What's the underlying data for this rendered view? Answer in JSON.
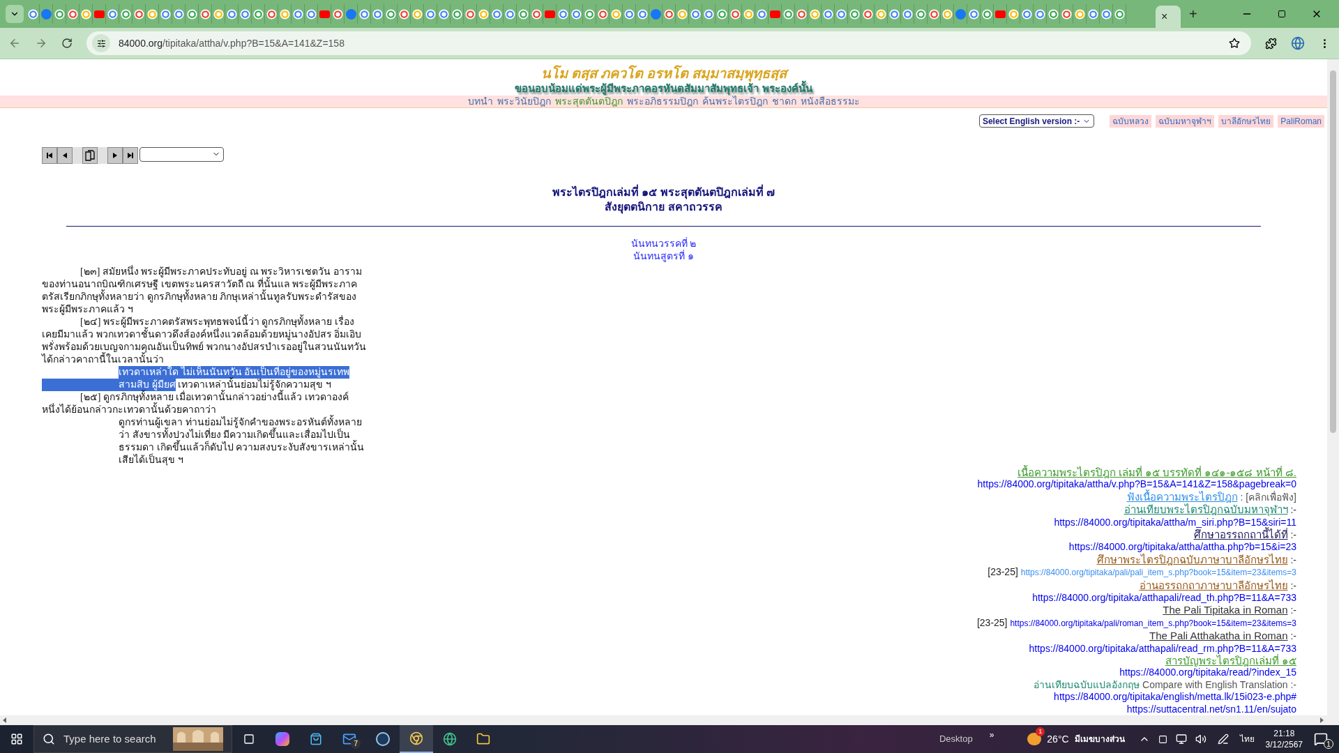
{
  "browser": {
    "url_host": "84000.org",
    "url_path": "/tipitaka/attha/v.php?B=15&A=141&Z=158",
    "close_tab": "×",
    "new_tab": "+"
  },
  "header": {
    "title": "นโม ตสฺส ภควโต อรหโต สมฺมาสมฺพุทฺธสฺส",
    "subtitle": "ขอนอบน้อมแด่พระผู้มีพระภาคอรหันตสัมมาสัมพุทธเจ้า  พระองค์นั้น"
  },
  "nav": [
    {
      "label": "บทนำ",
      "selected": false
    },
    {
      "label": "พระวินัยปิฎก",
      "selected": false
    },
    {
      "label": "พระสุตตันตปิฎก",
      "selected": true
    },
    {
      "label": "พระอภิธรรมปิฎก",
      "selected": false
    },
    {
      "label": "ค้นพระไตรปิฎก",
      "selected": false
    },
    {
      "label": "ชาดก",
      "selected": false
    },
    {
      "label": "หนังสือธรรมะ",
      "selected": false
    }
  ],
  "version_select": "Select English version :-",
  "version_links": [
    "ฉบับหลวง",
    "ฉบับมหาจุฬาฯ",
    "บาลีอักษรไทย",
    "PaliRoman"
  ],
  "title": [
    "พระไตรปิฎกเล่มที่ ๑๕ พระสุตตันตปิฎกเล่มที่ ๗",
    "สังยุตตนิกาย สคาถวรรค"
  ],
  "subheads": [
    "นันทนวรรคที่ ๒",
    "นันทนสูตรที่ ๑"
  ],
  "body": [
    {
      "kind": "para",
      "lines": [
        "[๒๓] สมัยหนึ่ง พระผู้มีพระภาคประทับอยู่ ณ พระวิหารเชตวัน อาราม",
        "ของท่านอนาถบิณฑิกเศรษฐี เขตพระนครสาวัตถี ณ ที่นั้นแล พระผู้มีพระภาค",
        "ตรัสเรียกภิกษุทั้งหลายว่า ดูกรภิกษุทั้งหลาย ภิกษุเหล่านั้นทูลรับพระดำรัสของ",
        "พระผู้มีพระภาคแล้ว ฯ"
      ]
    },
    {
      "kind": "para",
      "lines": [
        "[๒๔] พระผู้มีพระภาคตรัสพระพุทธพจน์นี้ว่า ดูกรภิกษุทั้งหลาย เรื่อง",
        "เคยมีมาแล้ว พวกเทวดาชั้นดาวดึงส์องค์หนึ่งแวดล้อมด้วยหมู่นางอัปสร อิ่มเอิบ",
        "พรั่งพร้อมด้วยเบญจกามคุณอันเป็นทิพย์ พวกนางอัปสรบำเรออยู่ในสวนนันทวัน",
        "ได้กล่าวคาถานี้ในเวลานั้นว่า"
      ]
    },
    {
      "kind": "verse",
      "lines": [
        [
          {
            "text": "เทวดาเหล่าใด ไม่เห็นนันทวัน อันเป็นที่อยู่ของหมู่นรเทพ",
            "highlighted": true
          }
        ],
        [
          {
            "text": "สามสิบ ผู้มียศ",
            "highlighted": true
          },
          {
            "text": " เทวดาเหล่านั้นย่อมไม่รู้จักความสุข ฯ",
            "highlighted": false
          }
        ]
      ]
    },
    {
      "kind": "para",
      "lines": [
        "[๒๕] ดูกรภิกษุทั้งหลาย เมื่อเทวดานั้นกล่าวอย่างนี้แล้ว เทวดาองค์",
        "หนึ่งได้ย้อนกล่าวกะเทวดานั้นด้วยคาถาว่า"
      ]
    },
    {
      "kind": "verse",
      "lines": [
        [
          {
            "text": "ดูกรท่านผู้เขลา ท่านย่อมไม่รู้จักคำของพระอรหันต์ทั้งหลาย",
            "highlighted": false
          }
        ],
        [
          {
            "text": "ว่า สังขารทั้งปวงไม่เที่ยง มีความเกิดขึ้นและเสื่อมไปเป็น",
            "highlighted": false
          }
        ],
        [
          {
            "text": "ธรรมดา เกิดขึ้นแล้วก็ดับไป ความสงบระงับสังขารเหล่านั้น",
            "highlighted": false
          }
        ],
        [
          {
            "text": "เสียได้เป็นสุข ฯ",
            "highlighted": false
          }
        ]
      ]
    }
  ],
  "references": [
    [
      {
        "kind": "link",
        "text": "เนื้อความพระไตรปิฎก เล่มที่ ๑๕ บรรทัดที่ ๑๔๑-๑๕๘ หน้าที่ ๘.",
        "color": "#3f9a2e"
      }
    ],
    [
      {
        "kind": "url",
        "text": "https://84000.org/tipitaka/attha/v.php?B=15&A=141&Z=158&pagebreak=0",
        "color": "#0000ee"
      }
    ],
    [
      {
        "kind": "link",
        "text": "ฟังเนื้อความพระไตรปิฎก",
        "color": "#2f8fe8"
      },
      {
        "kind": "note",
        "text": " : [คลิกเพื่อฟัง]",
        "color": "#555555"
      }
    ],
    [
      {
        "kind": "link",
        "text": "อ่านเทียบพระไตรปิฎกฉบับมหาจุฬาฯ",
        "color": "#1e8a72"
      },
      {
        "kind": "note",
        "text": " :-",
        "color": "#333333"
      }
    ],
    [
      {
        "kind": "url",
        "text": "https://84000.org/tipitaka/attha/m_siri.php?B=15&siri=11",
        "color": "#0000ee"
      }
    ],
    [
      {
        "kind": "link",
        "text": "ศึกษาอรรถกถานี้ได้ที่",
        "color": "#1a1a5a"
      },
      {
        "kind": "note",
        "text": " :-",
        "color": "#333333"
      }
    ],
    [
      {
        "kind": "url",
        "text": "https://84000.org/tipitaka/attha/attha.php?b=15&i=23",
        "color": "#0000ee"
      }
    ],
    [
      {
        "kind": "link",
        "text": "ศึกษาพระไตรปิฎกฉบับภาษาบาลีอักษรไทย",
        "color": "#9a5a1a"
      },
      {
        "kind": "note",
        "text": " :-",
        "color": "#333333"
      }
    ],
    [
      {
        "kind": "note",
        "text": "[23-25] ",
        "color": "#222222"
      },
      {
        "kind": "small_url",
        "text": "https://84000.org/tipitaka/pali/pali_item_s.php?book=15&item=23&items=3",
        "color": "#3a8ef0"
      }
    ],
    [
      {
        "kind": "link",
        "text": "อ่านอรรถกถาภาษาบาลีอักษรไทย",
        "color": "#9a5a1a"
      },
      {
        "kind": "note",
        "text": " :-",
        "color": "#333333"
      }
    ],
    [
      {
        "kind": "url",
        "text": "https://84000.org/tipitaka/atthapali/read_th.php?B=11&A=733",
        "color": "#0000ee"
      }
    ],
    [
      {
        "kind": "link",
        "text": "The Pali Tipitaka in Roman",
        "color": "#333333"
      },
      {
        "kind": "note",
        "text": " :-",
        "color": "#333333"
      }
    ],
    [
      {
        "kind": "note",
        "text": "[23-25] ",
        "color": "#222222"
      },
      {
        "kind": "small_url",
        "text": "https://84000.org/tipitaka/pali/roman_item_s.php?book=15&item=23&items=3",
        "color": "#0000ee"
      }
    ],
    [
      {
        "kind": "link",
        "text": "The Pali Atthakatha in Roman",
        "color": "#333333"
      },
      {
        "kind": "note",
        "text": " :-",
        "color": "#333333"
      }
    ],
    [
      {
        "kind": "url",
        "text": "https://84000.org/tipitaka/atthapali/read_rm.php?B=11&A=733",
        "color": "#0000ee"
      }
    ],
    [
      {
        "kind": "link",
        "text": "สารบัญพระไตรปิฎกเล่มที่ ๑๕",
        "color": "#3f9a2e"
      }
    ],
    [
      {
        "kind": "url",
        "text": "https://84000.org/tipitaka/read/?index_15",
        "color": "#0000ee"
      }
    ],
    [
      {
        "kind": "note",
        "text": "อ่านเทียบฉบับแปลอังกฤษ",
        "color": "#1e8a72"
      },
      {
        "kind": "note",
        "text": " Compare with English Translation :-",
        "color": "#555555"
      }
    ],
    [
      {
        "kind": "url",
        "text": "https://84000.org/tipitaka/english/metta.lk/15i023-e.php#",
        "color": "#0000ee"
      }
    ],
    [
      {
        "kind": "url",
        "text": "https://suttacentral.net/sn1.11/en/sujato",
        "color": "#0000ee"
      }
    ]
  ],
  "taskbar": {
    "search_placeholder": "Type here to search",
    "mail_badge": "7",
    "desktop": "Desktop",
    "more": "»",
    "weather_badge": "1",
    "temperature": "26°C",
    "weather": "มีเมฆบางส่วน",
    "language": "ไทย",
    "time": "21:18",
    "date": "3/12/2567",
    "notifications": "1"
  }
}
